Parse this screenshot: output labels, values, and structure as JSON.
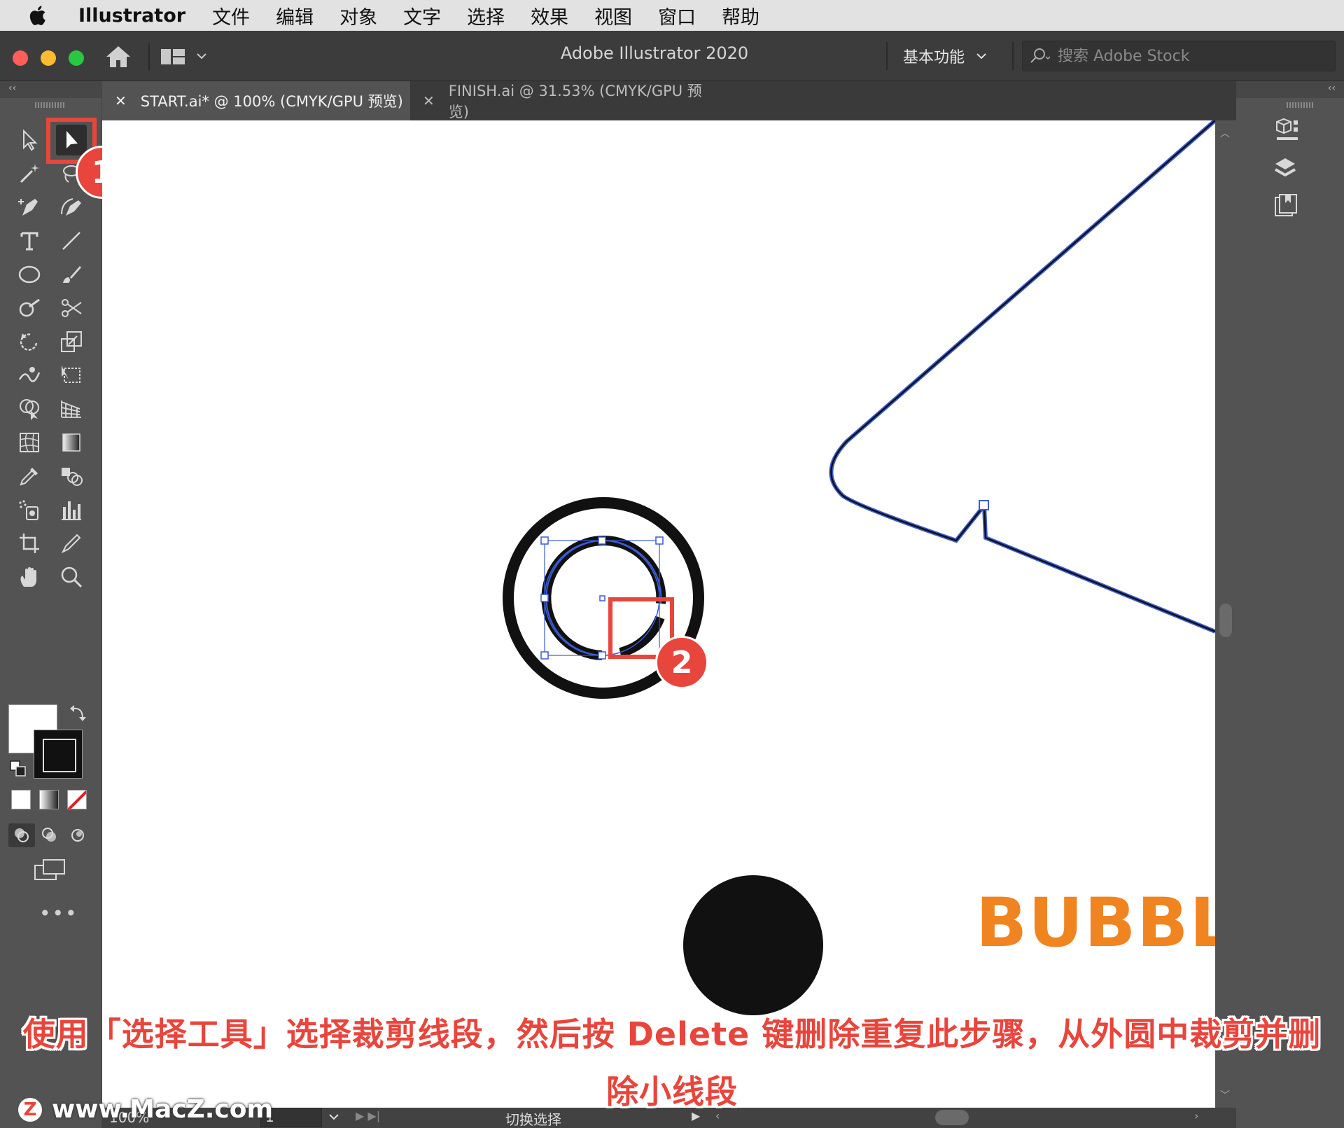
{
  "menubar": {
    "app_name": "Illustrator",
    "items": [
      "文件",
      "编辑",
      "对象",
      "文字",
      "选择",
      "效果",
      "视图",
      "窗口",
      "帮助"
    ]
  },
  "titlebar": {
    "title": "Adobe Illustrator 2020",
    "workspace": "基本功能",
    "search_placeholder": "搜索 Adobe Stock"
  },
  "tabs": [
    {
      "label": "START.ai* @ 100% (CMYK/GPU 预览)",
      "active": true
    },
    {
      "label": "FINISH.ai @ 31.53% (CMYK/GPU 预览)",
      "active": false
    }
  ],
  "canvas": {
    "brand_text": "BUBBL",
    "colors": {
      "accent": "#f08420",
      "selection": "#3a5cd8",
      "ink": "#111111"
    }
  },
  "annotations": {
    "badge_1": "1",
    "badge_2": "2",
    "highlight_color": "#e8453c"
  },
  "statusbar": {
    "zoom": "100%",
    "artboard": "1",
    "label": "切换选择"
  },
  "overlay": {
    "caption": "使用「选择工具」选择裁剪线段，然后按 Delete 键删除重复此步骤，从外圆中裁剪并删除小线段",
    "watermark": "www.MacZ.com",
    "watermark_logo": "Z"
  },
  "tools": [
    "selection-tool",
    "direct-selection-tool",
    "magic-wand-tool",
    "lasso-tool",
    "pen-tool",
    "curvature-tool",
    "type-tool",
    "line-segment-tool",
    "ellipse-tool",
    "paintbrush-tool",
    "shaper-tool",
    "scissors-tool",
    "rotate-tool",
    "scale-tool",
    "warp-tool",
    "free-transform-tool",
    "shape-builder-tool",
    "perspective-grid-tool",
    "mesh-tool",
    "gradient-tool",
    "eyedropper-tool",
    "blend-tool",
    "symbol-sprayer-tool",
    "column-graph-tool",
    "artboard-tool",
    "slice-tool",
    "hand-tool",
    "zoom-tool"
  ]
}
